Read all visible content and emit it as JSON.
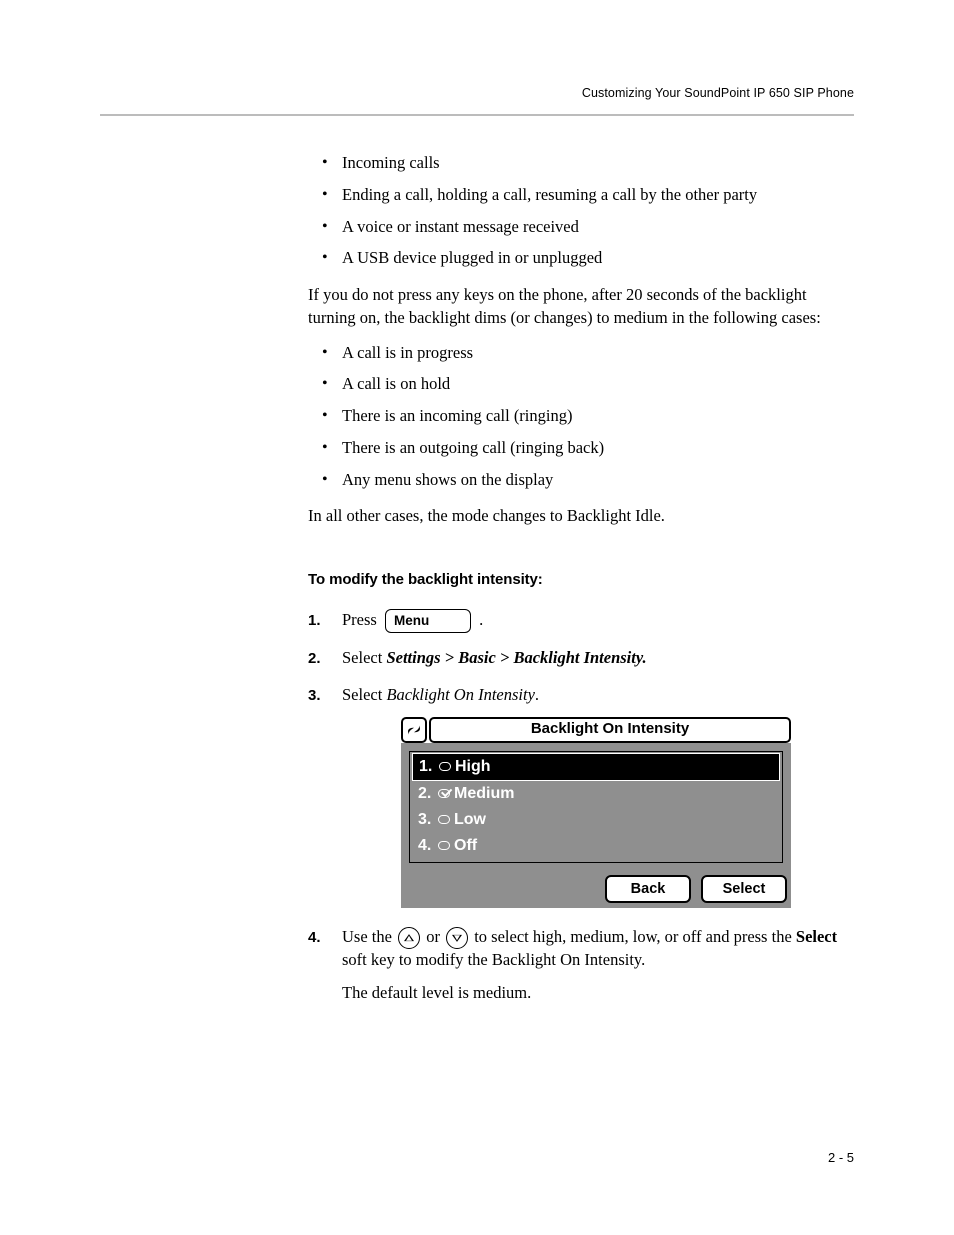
{
  "running_head": "Customizing Your SoundPoint IP 650 SIP Phone",
  "list_a": [
    "Incoming calls",
    "Ending a call, holding a call, resuming a call by the other party",
    "A voice or instant message received",
    "A USB device plugged in or unplugged"
  ],
  "para_1": "If you do not press any keys on the phone, after 20 seconds of the backlight turning on, the backlight dims (or changes) to medium in the following cases:",
  "list_b": [
    "A call is in progress",
    "A call is on hold",
    "There is an incoming call (ringing)",
    "There is an outgoing call (ringing back)",
    "Any menu shows on the display"
  ],
  "para_2": "In all other cases, the mode changes to Backlight Idle.",
  "section_heading": "To modify the backlight intensity:",
  "steps": {
    "s1_press": "Press ",
    "s1_button": "Menu",
    "s1_period": " .",
    "s2_prefix": "Select ",
    "s2_path": "Settings > Basic > Backlight Intensity.",
    "s3_prefix": "Select ",
    "s3_item": "Backlight On Intensity",
    "s3_period": ".",
    "s4_prefix": "Use the ",
    "s4_mid": " or ",
    "s4_tail": " to select high, medium, low, or off and press the ",
    "s4_bold": "Select",
    "s4_after_bold": " soft key to modify the Backlight On Intensity.",
    "s4_sub": "The default level is medium."
  },
  "phone": {
    "title": "Backlight On Intensity",
    "items": [
      {
        "idx": "1.",
        "checked": false,
        "label": "High",
        "selected": true
      },
      {
        "idx": "2.",
        "checked": true,
        "label": "Medium",
        "selected": false
      },
      {
        "idx": "3.",
        "checked": false,
        "label": "Low",
        "selected": false
      },
      {
        "idx": "4.",
        "checked": false,
        "label": "Off",
        "selected": false
      }
    ],
    "softkeys": {
      "back": "Back",
      "select": "Select"
    }
  },
  "page_number": "2 - 5"
}
